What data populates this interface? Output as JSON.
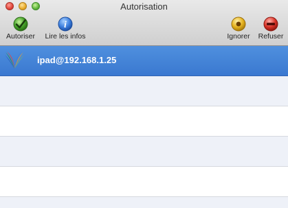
{
  "window": {
    "title": "Autorisation"
  },
  "toolbar": {
    "authorize_label": "Autoriser",
    "info_label": "Lire les infos",
    "ignore_label": "Ignorer",
    "refuse_label": "Refuser"
  },
  "devices": [
    {
      "name": "ipad@192.168.1.25",
      "selected": true
    }
  ],
  "colors": {
    "selection": "#3a78d0",
    "alternate_row": "#eef1f8"
  }
}
